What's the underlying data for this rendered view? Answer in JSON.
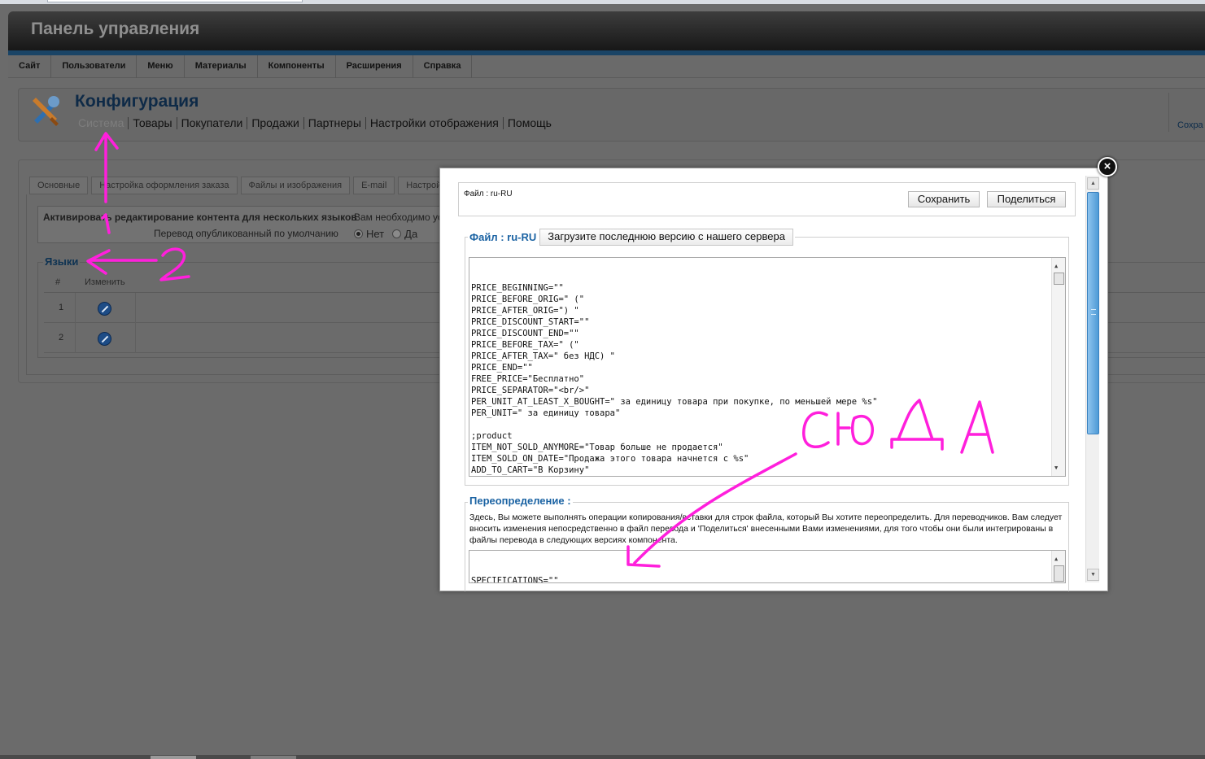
{
  "header": {
    "title": "Панель управления"
  },
  "main_menu": [
    "Сайт",
    "Пользователи",
    "Меню",
    "Материалы",
    "Компоненты",
    "Расширения",
    "Справка"
  ],
  "page": {
    "title": "Конфигурация",
    "submenu": [
      "Система",
      "Товары",
      "Покупатели",
      "Продажи",
      "Партнеры",
      "Настройки отображения",
      "Помощь"
    ],
    "save_label": "Сохра"
  },
  "tabs": [
    "Основные",
    "Настройка оформления заказа",
    "Файлы и изображения",
    "E-mail",
    "Настрой"
  ],
  "settings": {
    "row1_label": "Активировать редактирование контента для нескольких языков",
    "row1_value": "Вам необходимо уст",
    "row2_label": "Перевод опубликованный по умолчанию",
    "opt_no": "Нет",
    "opt_yes": "Да"
  },
  "languages": {
    "legend": "Языки",
    "col_num": "#",
    "col_edit": "Изменить",
    "rows": [
      "1",
      "2"
    ]
  },
  "modal": {
    "file_label": "Файл : ru-RU",
    "save_button": "Сохранить",
    "share_button": "Поделиться",
    "file_legend": "Файл : ru-RU",
    "download_button": "Загрузите последнюю версию с нашего сервера",
    "file_text": "PRICE_BEGINNING=\"\"\nPRICE_BEFORE_ORIG=\" (\"\nPRICE_AFTER_ORIG=\") \"\nPRICE_DISCOUNT_START=\"\"\nPRICE_DISCOUNT_END=\"\"\nPRICE_BEFORE_TAX=\" (\"\nPRICE_AFTER_TAX=\" без НДС) \"\nPRICE_END=\"\"\nFREE_PRICE=\"Бесплатно\"\nPRICE_SEPARATOR=\"<br/>\"\nPER_UNIT_AT_LEAST_X_BOUGHT=\" за единицу товара при покупке, по меньшей мере %s\"\nPER_UNIT=\" за единицу товара\"\n\n;product\nITEM_NOT_SOLD_ANYMORE=\"Товар больше не продается\"\nITEM_SOLD_ON_DATE=\"Продажа этого товара начнется с %s\"\nADD_TO_CART=\"В Корзину\"\nNO_STOCK=\"Нет в наличии\"\nX_ITEMS_IN_STOCK=\"%s единиц товара на складе\"",
    "override_legend": "Переопределение :",
    "override_desc": "Здесь, Вы можете выполнять операции копирования/вставки для строк файла, который Вы хотите переопределить. Для переводчиков. Вам следует вносить изменения непосредственно в файл перевода и 'Поделиться' внесенными Вами изменениями, для того чтобы они были интегрированы в файлы перевода в следующих версиях компонента.",
    "override_text": "SPECIFICATIONS=\"\"\nPER_UNIT=\"\"\nPER_UNIT_AT_LEAST_X_BOUGHT=\" за %s\"",
    "close": "×"
  },
  "annotation": {
    "label_1": "1",
    "label_2": "2",
    "label_here": "СЮДА",
    "color": "#ff1fdc"
  },
  "colors": {
    "title_blue": "#0e2a47",
    "legend_blue": "#1b63a3",
    "annotation_magenta": "#ff1fdc"
  }
}
